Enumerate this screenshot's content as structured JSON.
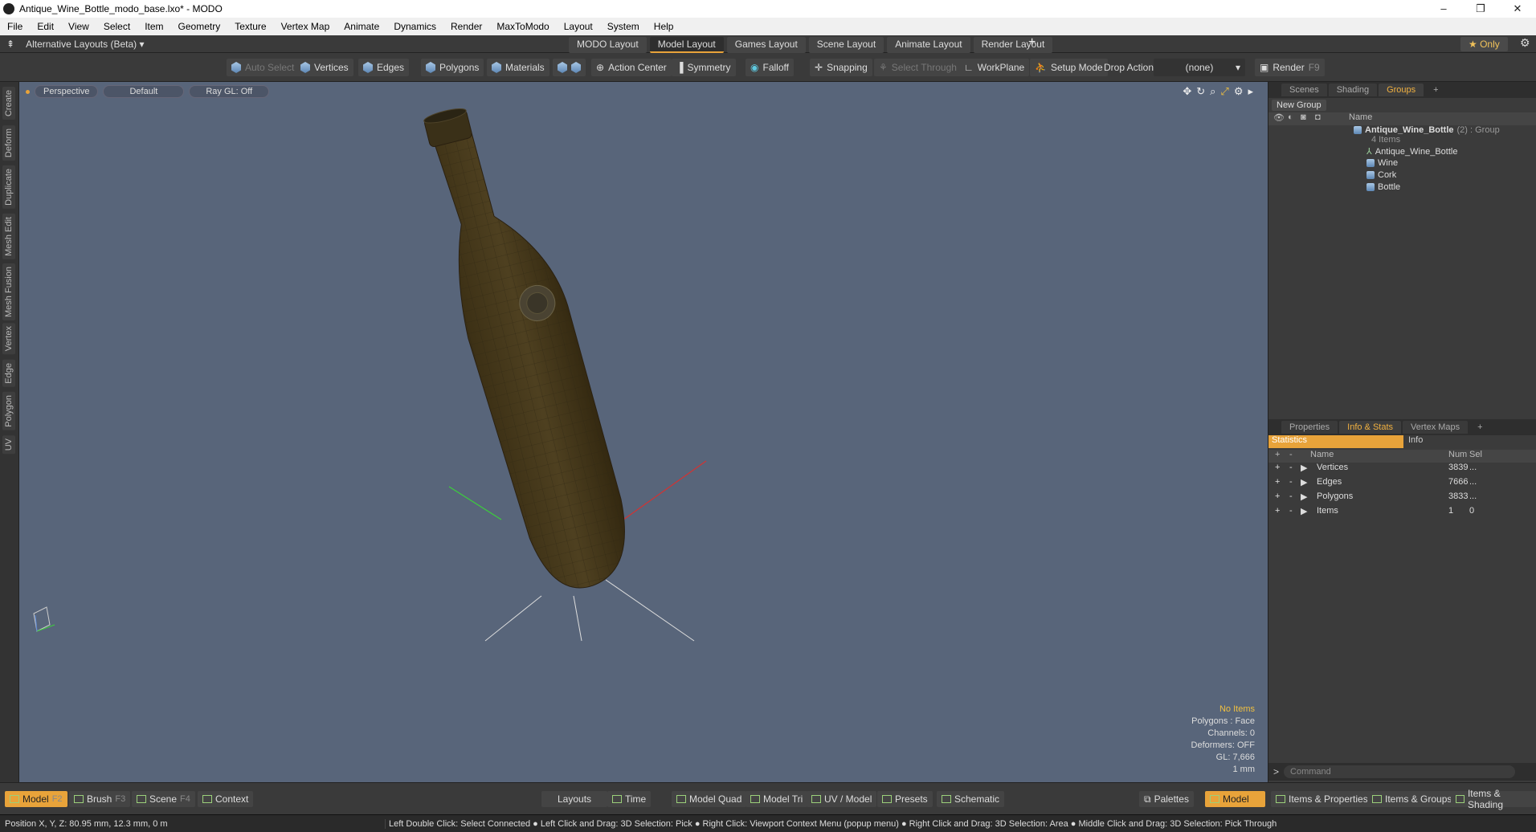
{
  "window": {
    "title": "Antique_Wine_Bottle_modo_base.lxo* - MODO",
    "buttons": [
      "–",
      "❐",
      "✕"
    ]
  },
  "menu": [
    "File",
    "Edit",
    "View",
    "Select",
    "Item",
    "Geometry",
    "Texture",
    "Vertex Map",
    "Animate",
    "Dynamics",
    "Render",
    "MaxToModo",
    "Layout",
    "System",
    "Help"
  ],
  "layoutbar": {
    "alt_layouts": "Alternative Layouts (Beta)",
    "tabs": [
      "MODO Layout",
      "Model Layout",
      "Games Layout",
      "Scene Layout",
      "Animate Layout",
      "Render Layout"
    ],
    "active_tab": "Model Layout",
    "add": "+",
    "only": "Only"
  },
  "toolbar": {
    "auto_select": "Auto Select",
    "vertices": "Vertices",
    "edges": "Edges",
    "polygons": "Polygons",
    "materials": "Materials",
    "action_center": "Action Center",
    "symmetry": "Symmetry",
    "falloff": "Falloff",
    "snapping": "Snapping",
    "select_through": "Select Through",
    "workplane": "WorkPlane",
    "setup_mode": "Setup Mode",
    "drop_action_label": "Drop Action",
    "drop_action_value": "(none)",
    "render": "Render",
    "render_key": "F9"
  },
  "left_tabs": [
    "Create",
    "Deform",
    "Duplicate",
    "Mesh Edit",
    "Mesh Fusion",
    "Vertex",
    "Edge",
    "Polygon",
    "UV"
  ],
  "viewport": {
    "view": "Perspective",
    "style": "Default",
    "raygl": "Ray GL: Off",
    "info": {
      "items": "No Items",
      "polygons": "Polygons : Face",
      "channels": "Channels: 0",
      "deformers": "Deformers: OFF",
      "gl": "GL: 7,666",
      "unit": "1 mm"
    }
  },
  "groups_panel": {
    "tabs": [
      "Scenes",
      "Shading",
      "Groups"
    ],
    "active": "Groups",
    "add": "+",
    "new_group": "New Group",
    "col_name": "Name",
    "group": {
      "name": "Antique_Wine_Bottle",
      "suffix": "(2) : Group",
      "count": "4 Items"
    },
    "children": [
      "Antique_Wine_Bottle",
      "Wine",
      "Cork",
      "Bottle"
    ]
  },
  "stats_panel": {
    "tabs": [
      "Properties",
      "Info & Stats",
      "Vertex Maps"
    ],
    "active": "Info & Stats",
    "add": "+",
    "statistics": "Statistics",
    "info": "Info",
    "col_name": "Name",
    "col_num": "Num",
    "col_sel": "Sel",
    "rows": [
      {
        "name": "Vertices",
        "num": "3839",
        "sel": "..."
      },
      {
        "name": "Edges",
        "num": "7666",
        "sel": "..."
      },
      {
        "name": "Polygons",
        "num": "3833",
        "sel": "..."
      },
      {
        "name": "Items",
        "num": "1",
        "sel": "0"
      }
    ]
  },
  "command": {
    "placeholder": "Command"
  },
  "bottombar": {
    "model": "Model",
    "model_key": "F2",
    "brush": "Brush",
    "brush_key": "F3",
    "scene": "Scene",
    "scene_key": "F4",
    "context": "Context",
    "layouts": "Layouts",
    "time": "Time",
    "model_quad": "Model Quad",
    "model_tri": "Model Tri",
    "uv_model": "UV / Model",
    "presets": "Presets",
    "schematic": "Schematic",
    "palettes": "Palettes",
    "model_r": "Model",
    "items_props": "Items & Properties",
    "items_groups": "Items & Groups",
    "items_shading": "Items & Shading"
  },
  "status": {
    "position": "Position X, Y, Z:   80.95 mm, 12.3 mm, 0 m",
    "hint": "Left Double Click: Select Connected ● Left Click and Drag: 3D Selection: Pick ● Right Click: Viewport Context Menu (popup menu) ● Right Click and Drag: 3D Selection: Area ● Middle Click and Drag: 3D Selection: Pick Through"
  }
}
